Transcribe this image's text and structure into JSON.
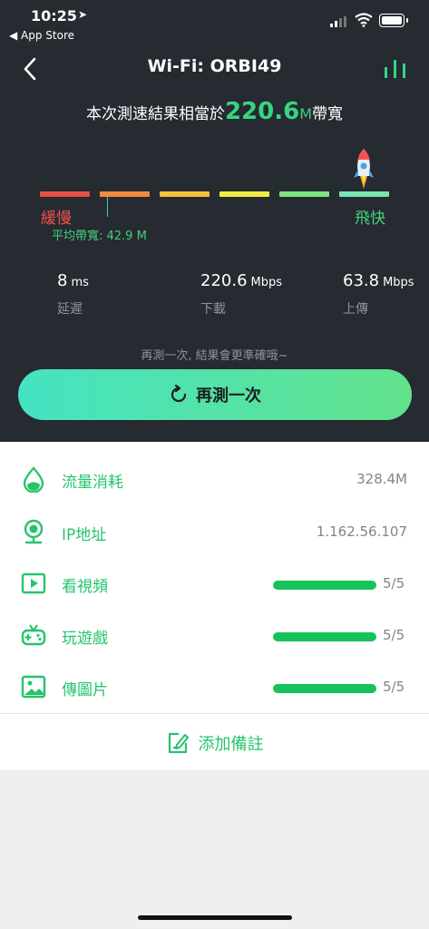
{
  "status_bar": {
    "time": "10:25",
    "back_to": "◀ App Store",
    "location_arrow": "➤"
  },
  "header": {
    "title": "Wi-Fi: ORBI49"
  },
  "result": {
    "prefix": "本次測速結果相當於",
    "value": "220.6",
    "unit": "M",
    "suffix": "帶寬"
  },
  "scale": {
    "slow_label": "緩慢",
    "fast_label": "飛快",
    "average_label": "平均帶寬: 42.9 M",
    "segment_colors": [
      "#e44f44",
      "#f18b3f",
      "#f6c23d",
      "#f3ec45",
      "#7be67e",
      "#79e6b2"
    ]
  },
  "metrics": [
    {
      "value": "8",
      "unit": "ms",
      "label": "延遲"
    },
    {
      "value": "220.6",
      "unit": "Mbps",
      "label": "下載"
    },
    {
      "value": "63.8",
      "unit": "Mbps",
      "label": "上傳"
    }
  ],
  "hint": "再測一次, 結果會更準確哦~",
  "retest_button": "再測一次",
  "details": {
    "traffic": {
      "label": "流量消耗",
      "value": "328.4M"
    },
    "ip": {
      "label": "IP地址",
      "value": "1.162.56.107"
    },
    "video": {
      "label": "看視頻",
      "score": "5/5"
    },
    "games": {
      "label": "玩遊戲",
      "score": "5/5"
    },
    "images": {
      "label": "傳圖片",
      "score": "5/5"
    }
  },
  "add_note": "添加備註",
  "colors": {
    "accent_green": "#26c46c",
    "highlight_green": "#36d582",
    "dark_bg": "#262a31"
  }
}
